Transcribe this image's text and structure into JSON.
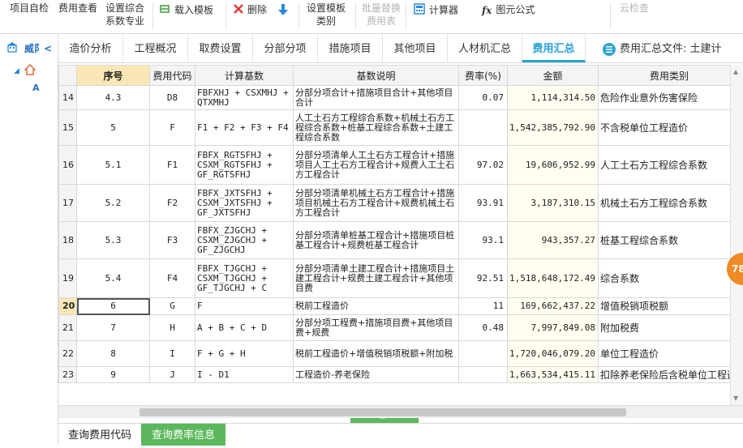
{
  "toolbar": {
    "self_check": "项目自检",
    "fee_view": "费用查看",
    "setup_coef_1": "设置综合",
    "setup_coef_2": "系数专业",
    "load_template": "载入模板",
    "delete": "删除",
    "setup_template_1": "设置模板",
    "setup_template_2": "类别",
    "batch_replace_1": "批量替换",
    "batch_replace_2": "费用表",
    "calculator": "计算器",
    "formula": "图元公式",
    "cloud_check": "云检查"
  },
  "left_panel": {
    "title": "威阝<"
  },
  "tabs": [
    {
      "label": "造价分析"
    },
    {
      "label": "工程概况"
    },
    {
      "label": "取费设置"
    },
    {
      "label": "分部分项"
    },
    {
      "label": "措施项目"
    },
    {
      "label": "其他项目"
    },
    {
      "label": "人材机汇总"
    },
    {
      "label": "费用汇总"
    }
  ],
  "file_label": "费用汇总文件: 土建计",
  "table": {
    "headers": [
      "序号",
      "费用代码",
      "计算基数",
      "基数说明",
      "费率(%)",
      "金额",
      "费用类别"
    ],
    "rows": [
      {
        "row": "14",
        "seq": "4.3",
        "code": "D8",
        "base": "FBFXHJ + CSXMHJ + QTXMHJ",
        "desc": "分部分项合计+措施项目合计+其他项目合计",
        "rate": "0.07",
        "amount": "1,114,314.50",
        "category": "危险作业意外伤害保险"
      },
      {
        "row": "15",
        "seq": "5",
        "code": "F",
        "base": "F1 + F2 + F3 + F4",
        "desc": "人工土石方工程综合系数+机械土石方工程综合系数+桩基工程综合系数+土建工程综合系数",
        "rate": "",
        "amount": "1,542,385,792.90",
        "category": "不含税单位工程造价"
      },
      {
        "row": "16",
        "seq": "5.1",
        "code": "F1",
        "base": "FBFX_RGTSFHJ + CSXM_RGTSFHJ + GF_RGTSFHJ",
        "desc": "分部分项清单人工土石方工程合计+措施项目人工土石方工程合计+规费人工土石方工程合计",
        "rate": "97.02",
        "amount": "19,606,952.99",
        "category": "人工土石方工程综合系数"
      },
      {
        "row": "17",
        "seq": "5.2",
        "code": "F2",
        "base": "FBFX_JXTSFHJ + CSXM_JXTSFHJ + GF_JXTSFHJ",
        "desc": "分部分项清单机械土石方工程合计+措施项目机械土石方工程合计+规费机械土石方工程合计",
        "rate": "93.91",
        "amount": "3,187,310.15",
        "category": "机械土石方工程综合系数"
      },
      {
        "row": "18",
        "seq": "5.3",
        "code": "F3",
        "base": "FBFX_ZJGCHJ + CSXM_ZJGCHJ + GF_ZJGCHJ",
        "desc": "分部分项清单桩基工程合计+措施项目桩基工程合计+规费桩基工程合计",
        "rate": "93.1",
        "amount": "943,357.27",
        "category": "桩基工程综合系数"
      },
      {
        "row": "19",
        "seq": "5.4",
        "code": "F4",
        "base": "FBFX_TJGCHJ + CSXM_TJGCHJ + GF_TJGCHJ + C",
        "desc": "分部分项清单土建工程合计+措施项目土建工程合计+规费土建工程合计+其他项目费",
        "rate": "92.51",
        "amount": "1,518,648,172.49",
        "category": "综合系数"
      },
      {
        "row": "20",
        "seq": "6",
        "code": "G",
        "base": "F",
        "desc": "税前工程造价",
        "rate": "11",
        "amount": "169,662,437.22",
        "category": "增值税销项税额"
      },
      {
        "row": "21",
        "seq": "7",
        "code": "H",
        "base": "A + B + C + D",
        "desc": "分部分项工程费+措施项目费+其他项目费+规费",
        "rate": "0.48",
        "amount": "7,997,849.08",
        "category": "附加税费"
      },
      {
        "row": "22",
        "seq": "8",
        "code": "I",
        "base": "F + G + H",
        "desc": "税前工程造价+增值税销项税额+附加税",
        "rate": "",
        "amount": "1,720,046,079.20",
        "category": "单位工程造价"
      },
      {
        "row": "23",
        "seq": "9",
        "code": "J",
        "base": "I - D1",
        "desc": "工程造价-养老保险",
        "rate": "",
        "amount": "1,663,534,415.11",
        "category": "扣除养老保险后含税单位工程造"
      }
    ]
  },
  "bottom_tabs": [
    {
      "label": "查询费用代码"
    },
    {
      "label": "查询费率信息"
    }
  ],
  "badge": "78",
  "colors": {
    "accent": "#2aa2d6",
    "green": "#5cb85c",
    "orange": "#f08a24",
    "highlight": "#fbe7b6"
  }
}
